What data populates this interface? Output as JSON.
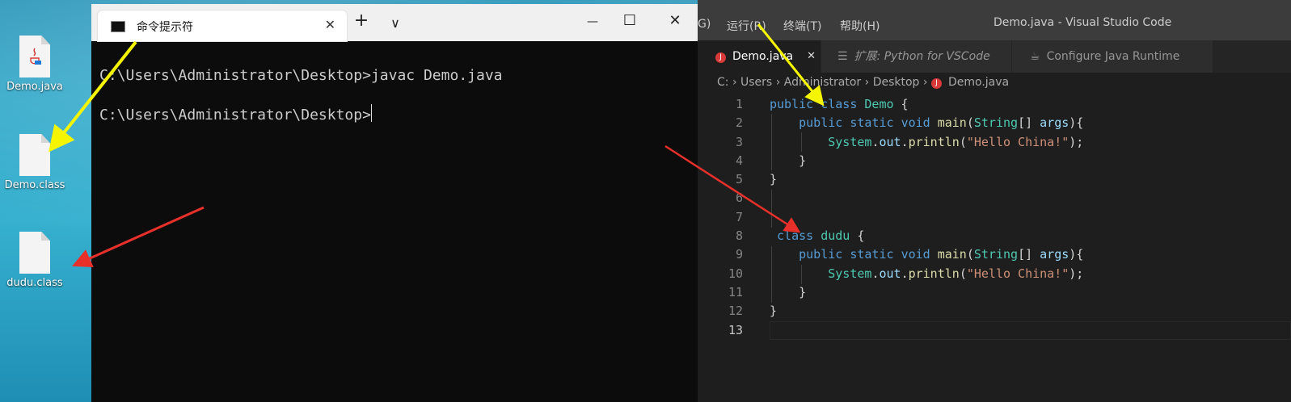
{
  "desktop": {
    "icons": [
      {
        "label": "Demo.java",
        "kind": "java"
      },
      {
        "label": "Demo.class",
        "kind": "blank"
      },
      {
        "label": "dudu.class",
        "kind": "blank"
      }
    ]
  },
  "cmd": {
    "tab_title": "命令提示符",
    "close_glyph": "✕",
    "new_tab_glyph": "+",
    "dropdown_glyph": "∨",
    "minimize_glyph": "—",
    "maximize_glyph": "☐",
    "window_close_glyph": "✕",
    "lines": [
      "C:\\Users\\Administrator\\Desktop>javac Demo.java",
      "C:\\Users\\Administrator\\Desktop>"
    ]
  },
  "vscode": {
    "menu": [
      "G)",
      "运行(R)",
      "终端(T)",
      "帮助(H)"
    ],
    "title": "Demo.java - Visual Studio Code",
    "tabs": [
      {
        "label": "Demo.java",
        "close": "✕",
        "active": true
      },
      {
        "label": "扩展: Python for VSCode",
        "active": false
      },
      {
        "label": "Configure Java Runtime",
        "active": false
      }
    ],
    "breadcrumb": [
      "C:",
      "Users",
      "Administrator",
      "Desktop",
      "Demo.java"
    ],
    "line_numbers": [
      "1",
      "2",
      "3",
      "4",
      "5",
      "6",
      "7",
      "8",
      "9",
      "10",
      "11",
      "12",
      "13"
    ],
    "code": {
      "l1": {
        "kw1": "public",
        "kw2": "class",
        "name": "Demo",
        "rest": " {"
      },
      "l2": {
        "kw1": "public",
        "kw2": "static",
        "kw3": "void",
        "fn": "main",
        "p1": "(",
        "type": "String",
        "p2": "[] ",
        "var": "args",
        "p3": "){"
      },
      "l3": {
        "t": "System",
        "d": ".",
        "o": "out",
        "d2": ".",
        "fn": "println",
        "p1": "(",
        "str": "\"Hello China!\"",
        "p2": ");"
      },
      "l4": "}",
      "l5": "}",
      "l8": {
        "kw": "class",
        "name": "dudu",
        "rest": " {"
      },
      "l12": "}"
    }
  },
  "colors": {
    "arrow_yellow": "#f5f500",
    "arrow_red": "#e8302a"
  }
}
